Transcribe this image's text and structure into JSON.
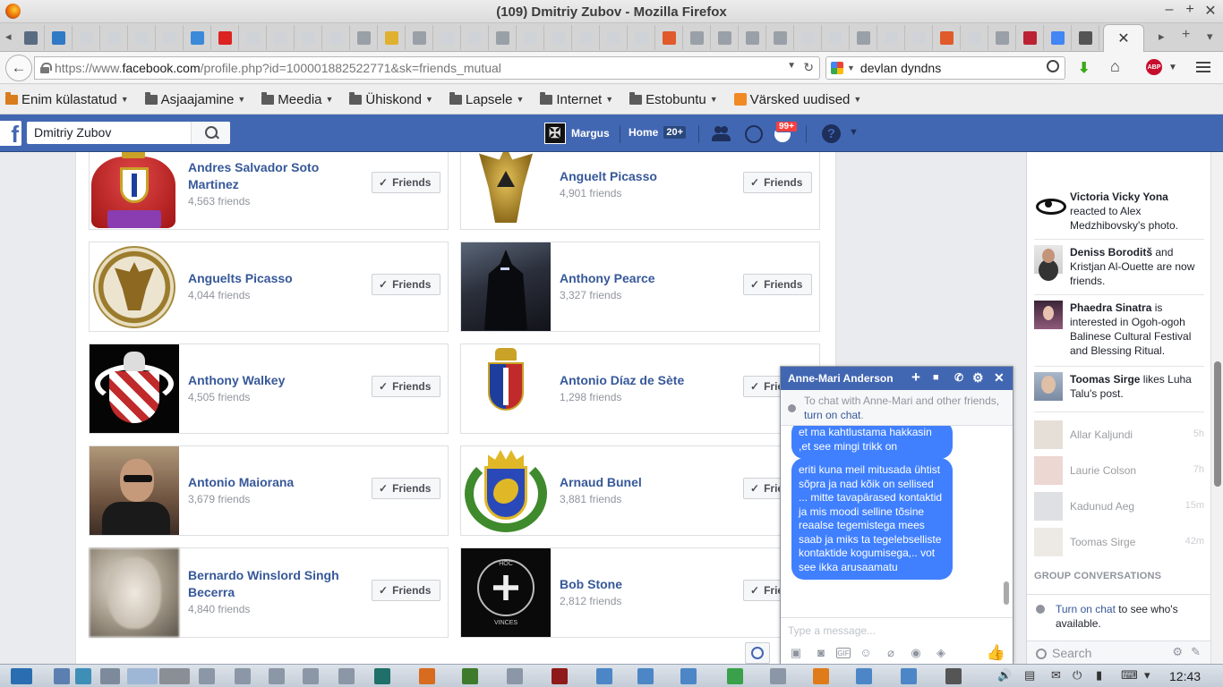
{
  "window": {
    "title": "(109) Dmitriy Zubov - Mozilla Firefox"
  },
  "browser": {
    "url_prefix": "https://www.",
    "url_host": "facebook.com",
    "url_path": "/profile.php?id=100001882522771&sk=friends_mutual",
    "search_value": "devlan dyndns"
  },
  "bookmarks": [
    {
      "label": "Enim külastatud",
      "icon": "folder-orange-icon"
    },
    {
      "label": "Asjaajamine",
      "icon": "folder-icon"
    },
    {
      "label": "Meedia",
      "icon": "folder-icon"
    },
    {
      "label": "Ühiskond",
      "icon": "folder-icon"
    },
    {
      "label": "Lapsele",
      "icon": "folder-icon"
    },
    {
      "label": "Internet",
      "icon": "folder-icon"
    },
    {
      "label": "Estobuntu",
      "icon": "folder-icon"
    },
    {
      "label": "Värsked uudised",
      "icon": "rss-icon"
    }
  ],
  "facebook": {
    "search_value": "Dmitriy Zubov",
    "user_name": "Margus",
    "home_label": "Home",
    "home_count": "20+",
    "notifications_badge": "99+",
    "brand_color": "#4267b2",
    "friend_button_label": "Friends"
  },
  "friends": [
    {
      "name": "Andres Salvador Soto Martinez",
      "count": "4,563 friends",
      "avatar": "crest-red"
    },
    {
      "name": "Anguelt Picasso",
      "count": "4,901 friends",
      "avatar": "eagle-gold"
    },
    {
      "name": "Anguelts Picasso",
      "count": "4,044 friends",
      "avatar": "medallion"
    },
    {
      "name": "Anthony Pearce",
      "count": "3,327 friends",
      "avatar": "dark-knight"
    },
    {
      "name": "Anthony Walkey",
      "count": "4,505 friends",
      "avatar": "black-crest"
    },
    {
      "name": "Antonio Díaz de Sète",
      "count": "1,298 friends",
      "avatar": "white-crest"
    },
    {
      "name": "Antonio Maiorana",
      "count": "3,679 friends",
      "avatar": "photo-man"
    },
    {
      "name": "Arnaud Bunel",
      "count": "3,881 friends",
      "avatar": "green-crest"
    },
    {
      "name": "Bernardo Winslord Singh Becerra",
      "count": "4,840 friends",
      "avatar": "blurry"
    },
    {
      "name": "Bob Stone",
      "count": "2,812 friends",
      "avatar": "hoc"
    }
  ],
  "ticker": {
    "stories": [
      {
        "actor": "Victoria Vicky Yona",
        "text": " reacted to Alex Medzhibovsky's photo."
      },
      {
        "actor": "Deniss Boroditš",
        "text": " and Kristjan Al-Ouette are now friends."
      },
      {
        "actor": "Phaedra Sinatra",
        "text": " is interested in Ogoh-ogoh Balinese Cultural Festival and Blessing Ritual."
      },
      {
        "actor": "Toomas Sirge",
        "text": " likes Luha Talu's post."
      }
    ],
    "contacts": [
      {
        "name": "Allar Kaljundi",
        "time": "5h"
      },
      {
        "name": "Laurie Colson",
        "time": "7h"
      },
      {
        "name": "Kadunud Aeg",
        "time": "15m"
      },
      {
        "name": "Toomas Sirge",
        "time": "42m"
      }
    ],
    "group_header": "GROUP CONVERSATIONS",
    "chat_link": "Turn on chat",
    "chat_text": " to see who's available.",
    "search_placeholder": "Search"
  },
  "chat": {
    "title": "Anne-Mari Anderson",
    "notice_text": "To chat with Anne-Mari and other friends, ",
    "notice_link": "turn on chat",
    "notice_end": ".",
    "messages": [
      "et ma kahtlustama hakkasin ,et see mingi trikk on",
      "eriti kuna meil mitusada ühtist sõpra ja nad kõik on sellised ... mitte tavapärased kontaktid ja mis moodi selline tõsine reaalse tegemistega mees saab ja miks ta tegelebselliste kontaktide kogumisega,.. vot see ikka arusaamatu"
    ],
    "input_placeholder": "Type a message...",
    "bubble_color": "#4080ff"
  },
  "taskbar": {
    "clock": "12:43"
  }
}
